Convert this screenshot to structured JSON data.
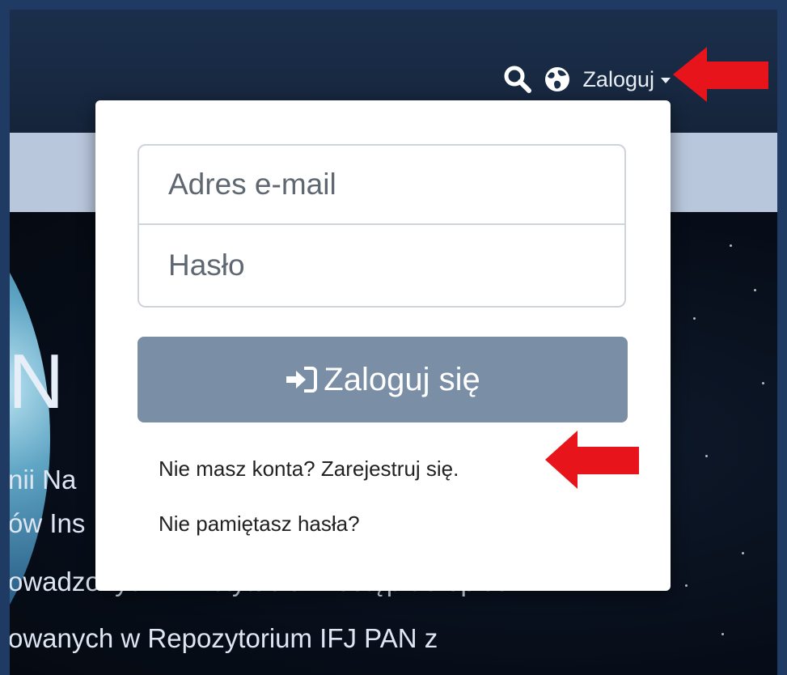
{
  "navbar": {
    "login_label": "Zaloguj"
  },
  "login_form": {
    "email_placeholder": "Adres e-mail",
    "password_placeholder": "Hasło",
    "submit_label": "Zaloguj się",
    "register_link": "Nie masz konta? Zarejestruj się.",
    "forgot_link": "Nie pamiętasz hasła?"
  },
  "hero": {
    "title_fragment": "N",
    "line1": "nii Na",
    "line2": "ów Ins",
    "line3": "owadzonych w instytucie. Dostęp do opisów",
    "line4": "owanych w Repozytorium IFJ PAN z"
  },
  "colors": {
    "navbar": "#1b2f4c",
    "strip": "#b9c7dc",
    "submit_button": "#7a8ea6",
    "annotation_arrow": "#e8141c"
  },
  "icons": {
    "search": "search-icon",
    "language": "globe-icon",
    "dropdown": "caret-down-icon",
    "login": "sign-in-icon",
    "annotation": "red-arrow-icon"
  }
}
